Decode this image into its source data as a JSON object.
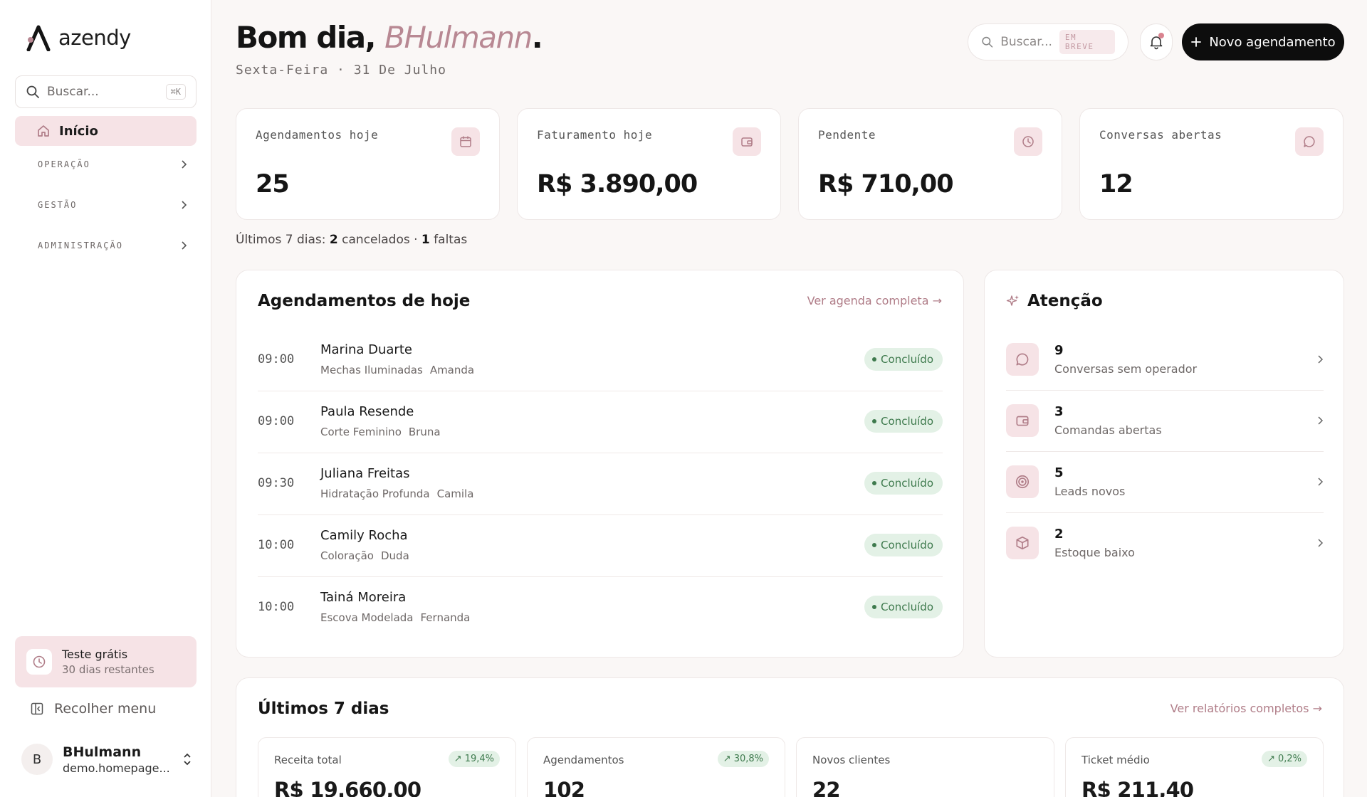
{
  "brand": {
    "name": "azendy",
    "accent": "#b88893",
    "accent_bg": "#f6e3e6"
  },
  "sidebar": {
    "search_placeholder": "Buscar...",
    "search_shortcut": "⌘K",
    "home_label": "Início",
    "groups": [
      {
        "label": "OPERAÇÃO"
      },
      {
        "label": "GESTÃO"
      },
      {
        "label": "ADMINISTRAÇÃO"
      }
    ],
    "trial": {
      "title": "Teste grátis",
      "subtitle": "30 dias restantes"
    },
    "collapse_label": "Recolher menu",
    "user": {
      "initial": "B",
      "name": "BHulmann",
      "email": "demo.homepage..."
    }
  },
  "header": {
    "greeting": "Bom dia,",
    "user_name": "BHulmann",
    "period": ".",
    "date": "Sexta-Feira · 31 De Julho",
    "search_placeholder": "Buscar...",
    "search_badge": "EM BREVE",
    "new_button_label": "Novo agendamento"
  },
  "kpis": [
    {
      "label": "Agendamentos hoje",
      "value": "25",
      "icon": "calendar-icon"
    },
    {
      "label": "Faturamento hoje",
      "value": "R$ 3.890,00",
      "icon": "wallet-icon"
    },
    {
      "label": "Pendente",
      "value": "R$ 710,00",
      "icon": "clock-icon"
    },
    {
      "label": "Conversas abertas",
      "value": "12",
      "icon": "chat-icon"
    }
  ],
  "summary": {
    "prefix": "Últimos 7 dias:",
    "canceled_count": "2",
    "canceled_label": "cancelados ·",
    "missed_count": "1",
    "missed_label": "faltas"
  },
  "appointments": {
    "title": "Agendamentos de hoje",
    "link": "Ver agenda completa →",
    "items": [
      {
        "time": "09:00",
        "client": "Marina Duarte",
        "service": "Mechas Iluminadas",
        "staff": "Amanda",
        "status": "Concluído"
      },
      {
        "time": "09:00",
        "client": "Paula Resende",
        "service": "Corte Feminino",
        "staff": "Bruna",
        "status": "Concluído"
      },
      {
        "time": "09:30",
        "client": "Juliana Freitas",
        "service": "Hidratação Profunda",
        "staff": "Camila",
        "status": "Concluído"
      },
      {
        "time": "10:00",
        "client": "Camily Rocha",
        "service": "Coloração",
        "staff": "Duda",
        "status": "Concluído"
      },
      {
        "time": "10:00",
        "client": "Tainá Moreira",
        "service": "Escova Modelada",
        "staff": "Fernanda",
        "status": "Concluído"
      }
    ]
  },
  "attention": {
    "title": "Atenção",
    "items": [
      {
        "count": "9",
        "label": "Conversas sem operador",
        "icon": "chat-icon"
      },
      {
        "count": "3",
        "label": "Comandas abertas",
        "icon": "wallet-icon"
      },
      {
        "count": "5",
        "label": "Leads novos",
        "icon": "target-icon"
      },
      {
        "count": "2",
        "label": "Estoque baixo",
        "icon": "box-icon"
      }
    ]
  },
  "last7": {
    "title": "Últimos 7 dias",
    "link": "Ver relatórios completos →",
    "cards": [
      {
        "label": "Receita total",
        "value": "R$ 19.660,00",
        "trend": "19,4%"
      },
      {
        "label": "Agendamentos",
        "value": "102",
        "trend": "30,8%"
      },
      {
        "label": "Novos clientes",
        "value": "22",
        "trend": ""
      },
      {
        "label": "Ticket médio",
        "value": "R$ 211,40",
        "trend": "0,2%"
      }
    ]
  }
}
